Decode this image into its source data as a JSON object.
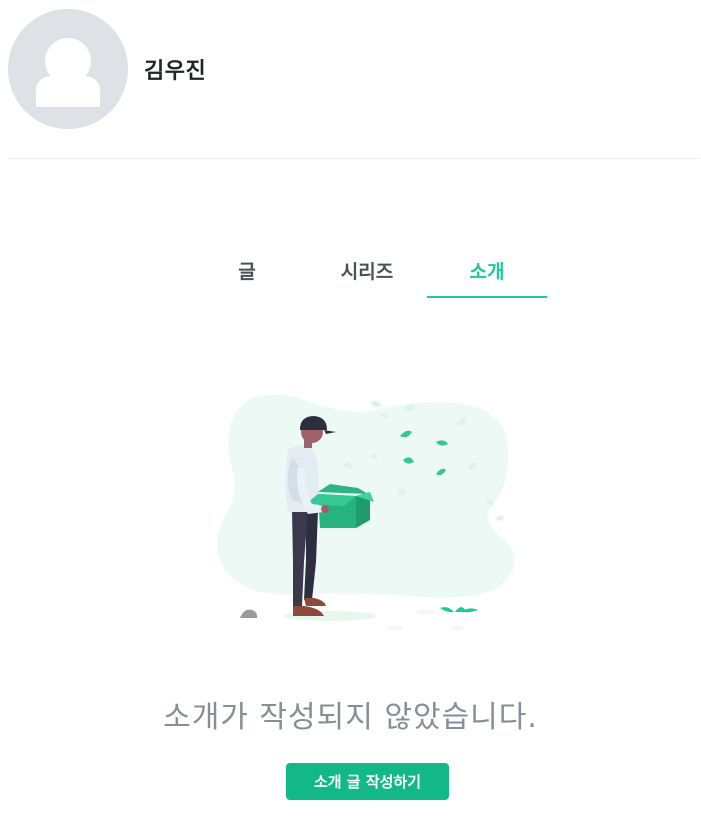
{
  "profile": {
    "name": "김우진"
  },
  "tabs": [
    {
      "label": "글"
    },
    {
      "label": "시리즈"
    },
    {
      "label": "소개"
    }
  ],
  "active_tab": "소개",
  "empty_state": {
    "message": "소개가 작성되지 않았습니다.",
    "button_label": "소개 글 작성하기"
  },
  "colors": {
    "accent": "#20c997",
    "button": "#12b886",
    "muted_text": "#868e96"
  }
}
